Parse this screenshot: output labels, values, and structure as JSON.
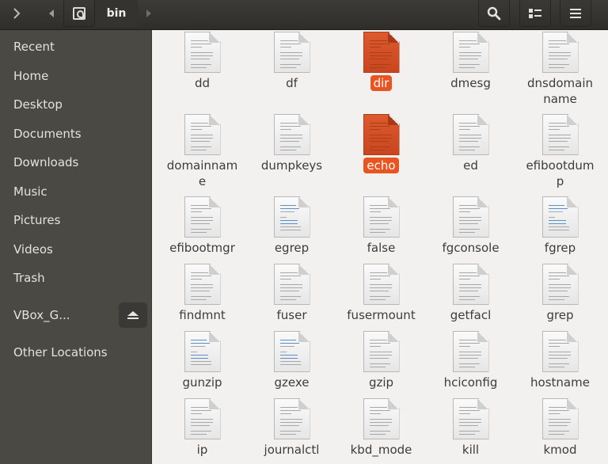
{
  "headerbar": {
    "back_icon": "chevron-right-icon",
    "path_left_icon": "triangle-left-icon",
    "path_home_icon": "home-drive-icon",
    "current_folder": "bin",
    "path_right_icon": "triangle-right-icon",
    "search_icon": "search-icon",
    "view_icon": "list-view-icon",
    "menu_icon": "hamburger-menu-icon"
  },
  "sidebar": {
    "items": [
      {
        "label": "Recent"
      },
      {
        "label": "Home"
      },
      {
        "label": "Desktop"
      },
      {
        "label": "Documents"
      },
      {
        "label": "Downloads"
      },
      {
        "label": "Music"
      },
      {
        "label": "Pictures"
      },
      {
        "label": "Videos"
      },
      {
        "label": "Trash"
      },
      {
        "label": "VBox_G...",
        "eject": true
      },
      {
        "label": "Other Locations"
      }
    ]
  },
  "colors": {
    "accent": "#e95420",
    "sidebar_bg": "#4a4944",
    "header_bg": "#34332f",
    "content_bg": "#f2f1f0"
  },
  "files": [
    {
      "name": "dd",
      "type": "text"
    },
    {
      "name": "df",
      "type": "text"
    },
    {
      "name": "dir",
      "type": "text",
      "selected": true
    },
    {
      "name": "dmesg",
      "type": "text"
    },
    {
      "name": "dnsdomainname",
      "type": "text"
    },
    {
      "name": "domainname",
      "type": "text"
    },
    {
      "name": "dumpkeys",
      "type": "text"
    },
    {
      "name": "echo",
      "type": "text",
      "selected": true
    },
    {
      "name": "ed",
      "type": "text"
    },
    {
      "name": "efibootdump",
      "type": "text"
    },
    {
      "name": "efibootmgr",
      "type": "text"
    },
    {
      "name": "egrep",
      "type": "script"
    },
    {
      "name": "false",
      "type": "text"
    },
    {
      "name": "fgconsole",
      "type": "text"
    },
    {
      "name": "fgrep",
      "type": "script"
    },
    {
      "name": "findmnt",
      "type": "text"
    },
    {
      "name": "fuser",
      "type": "text"
    },
    {
      "name": "fusermount",
      "type": "text"
    },
    {
      "name": "getfacl",
      "type": "text"
    },
    {
      "name": "grep",
      "type": "text"
    },
    {
      "name": "gunzip",
      "type": "script"
    },
    {
      "name": "gzexe",
      "type": "script"
    },
    {
      "name": "gzip",
      "type": "text"
    },
    {
      "name": "hciconfig",
      "type": "text"
    },
    {
      "name": "hostname",
      "type": "text"
    },
    {
      "name": "ip",
      "type": "text"
    },
    {
      "name": "journalctl",
      "type": "text"
    },
    {
      "name": "kbd_mode",
      "type": "text"
    },
    {
      "name": "kill",
      "type": "text"
    },
    {
      "name": "kmod",
      "type": "text"
    }
  ]
}
